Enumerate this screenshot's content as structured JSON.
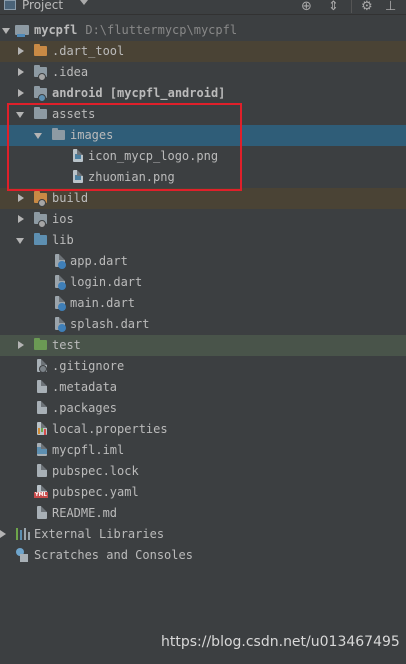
{
  "header": {
    "title": "Project"
  },
  "tree": {
    "root": {
      "name": "mycpfl",
      "path": "D:\\fluttermycp\\mycpfl"
    },
    "dart_tool": "dart_tool",
    "idea": ".idea",
    "android": "android [mycpfl_android]",
    "assets": "assets",
    "images": "images",
    "logo": "icon_mycp_logo.png",
    "zhuomian": "zhuomian.png",
    "build": "build",
    "ios": "ios",
    "lib": "lib",
    "app_dart": "app.dart",
    "login_dart": "login.dart",
    "main_dart": "main.dart",
    "splash_dart": "splash.dart",
    "test": "test",
    "gitignore": ".gitignore",
    "metadata": ".metadata",
    "packages": ".packages",
    "local_properties": "local.properties",
    "iml": "mycpfl.iml",
    "lock": "pubspec.lock",
    "yaml": "pubspec.yaml",
    "readme": "README.md",
    "ext_libs": "External Libraries",
    "scratches": "Scratches and Consoles"
  },
  "watermark": "https://blog.csdn.net/u013467495",
  "colors": {
    "background": "#3c3f41",
    "selection": "#2f5d78",
    "excluded": "#4a4335",
    "highlight_border": "#e0202a"
  }
}
